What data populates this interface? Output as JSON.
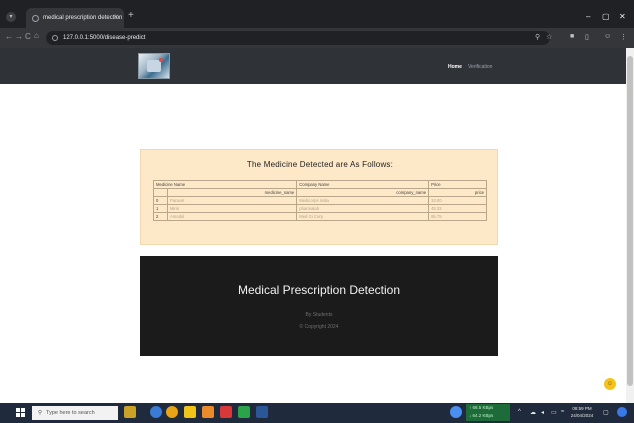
{
  "browser": {
    "tab_title": "medical prescription detection",
    "tab_close": "×",
    "new_tab": "+",
    "url": "127.0.0.1:5000/disease-predict",
    "win_min": "–",
    "win_max": "▢",
    "win_close": "✕",
    "nav_back": "←",
    "nav_forward": "→",
    "nav_reload": "C",
    "nav_home": "⌂"
  },
  "navbar": {
    "home": "Home",
    "verification": "Verification"
  },
  "result": {
    "title": "The Medicine Detected are As Follows:",
    "headers": {
      "medicine": "Medicine Name",
      "company": "Company Name",
      "price": "Price"
    },
    "subheaders": {
      "medicine": "medicine_name",
      "company": "company_name",
      "price": "price"
    },
    "rows": [
      {
        "index": "0",
        "medicine": "Paracet",
        "company": "Medicorps India",
        "price": "33.00"
      },
      {
        "index": "1",
        "medicine": "Mirin",
        "company": "pharmalab",
        "price": "45.32"
      },
      {
        "index": "2",
        "medicine": "Amodol",
        "company": "Med Gi Corp",
        "price": "85.75"
      }
    ]
  },
  "footer": {
    "title": "Medical Prescription Detection",
    "by": "By Students",
    "copyright": "© Copyright 2024"
  },
  "taskbar": {
    "search_placeholder": "Type here to search",
    "net_up": "↑ 68.5 KBps",
    "net_down": "↓ 64.2 KBps",
    "time": "08:59 PM",
    "date": "24/04/2024"
  },
  "colors": {
    "card_bg": "#fde8c8",
    "footer_bg": "#1b1b1b",
    "navbar_bg": "#2f3338"
  }
}
